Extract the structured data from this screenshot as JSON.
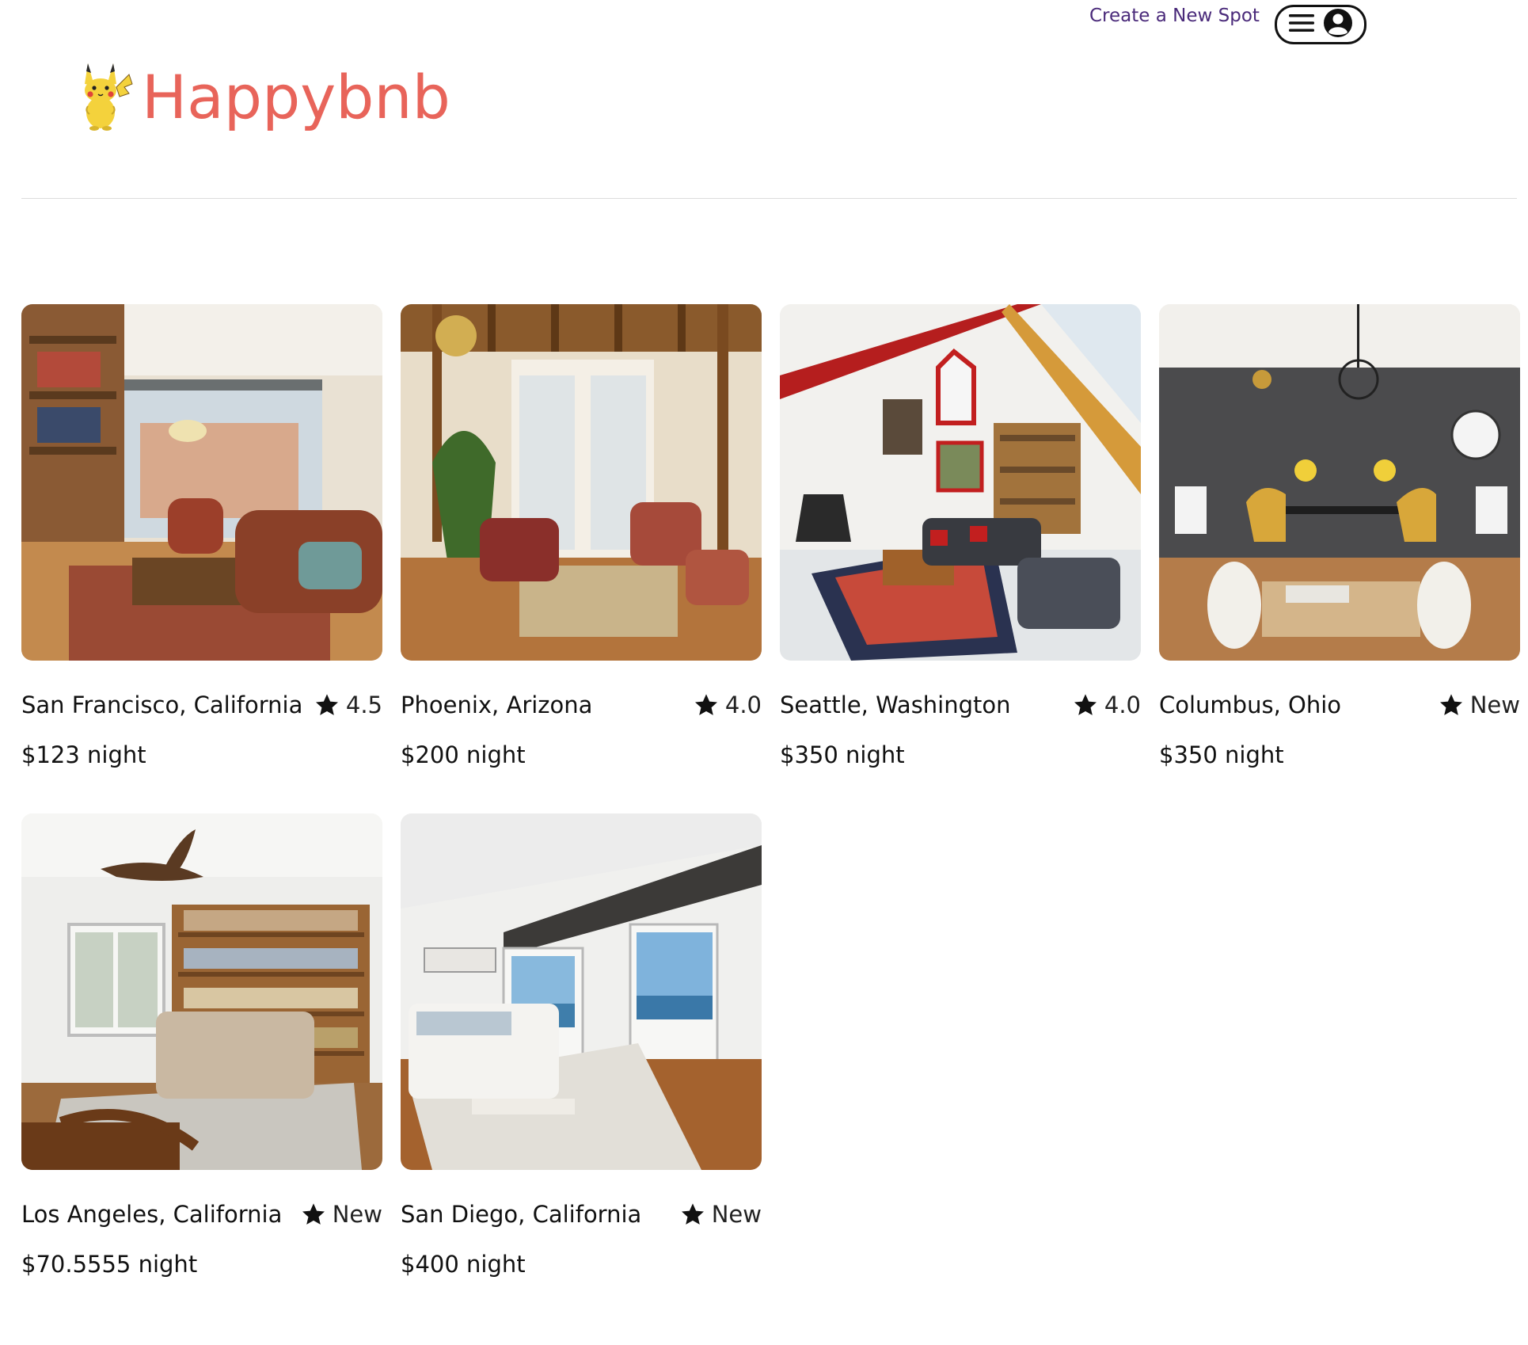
{
  "header": {
    "create_link": "Create a New Spot",
    "logo_text": "Happybnb",
    "brand_color": "#e8645a",
    "link_color": "#4a2a7a"
  },
  "icons": {
    "menu": "hamburger-icon",
    "profile": "user-circle-icon",
    "rating": "star-icon",
    "logo": "pikachu-logo"
  },
  "spots": [
    {
      "city": "San Francisco, California",
      "rating": "4.5",
      "price": "$123 night",
      "scene": "sunroom living room with bookshelves"
    },
    {
      "city": "Phoenix, Arizona",
      "rating": "4.0",
      "price": "$200 night",
      "scene": "timber-beamed living room"
    },
    {
      "city": "Seattle, Washington",
      "rating": "4.0",
      "price": "$350 night",
      "scene": "loft living room with fireplace"
    },
    {
      "city": "Columbus, Ohio",
      "rating": "New",
      "price": "$350 night",
      "scene": "dining room with dark wall"
    },
    {
      "city": "Los Angeles, California",
      "rating": "New",
      "price": "$70.5555 night",
      "scene": "living room with ceiling fan"
    },
    {
      "city": "San Diego, California",
      "rating": "New",
      "price": "$400 night",
      "scene": "ocean-view bedroom"
    }
  ]
}
